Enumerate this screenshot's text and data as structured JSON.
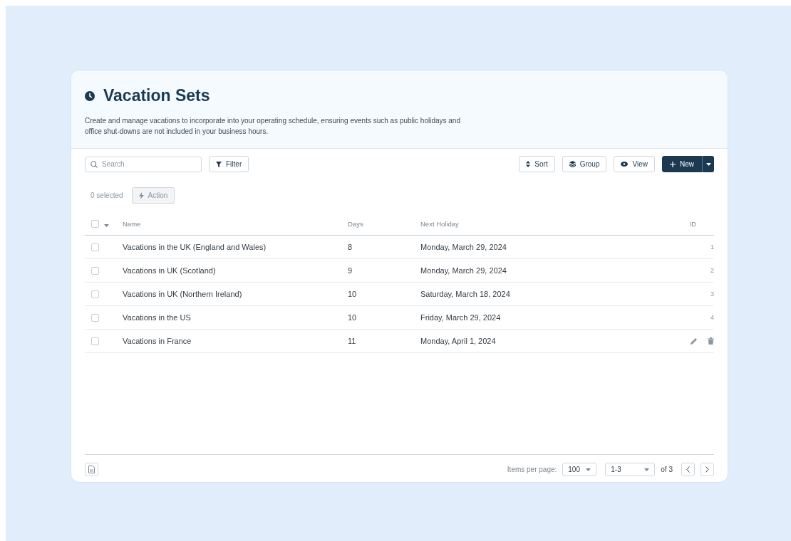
{
  "header": {
    "title": "Vacation Sets",
    "description": "Create and manage vacations to incorporate into your operating schedule, ensuring events such as public holidays and office shut-downs are not included in your business hours."
  },
  "toolbar": {
    "search": {
      "placeholder": "Search"
    },
    "filter": "Filter",
    "sort": "Sort",
    "group": "Group",
    "view": "View",
    "new": "New"
  },
  "selection": {
    "count": "0 selected",
    "action": "Action",
    "action_disabled": true
  },
  "table": {
    "select_all_checked": false,
    "columns": [
      "Name",
      "Days",
      "Next Holiday",
      "ID"
    ],
    "rows": [
      {
        "name": "Vacations in the UK (England and Wales)",
        "days": "8",
        "next_holiday": "Monday, March 29, 2024",
        "id": "1",
        "checked": false,
        "hovered": false
      },
      {
        "name": "Vacations in UK (Scotland)",
        "days": "9",
        "next_holiday": "Monday, March 29, 2024",
        "id": "2",
        "checked": false,
        "hovered": false
      },
      {
        "name": "Vacations in UK (Northern Ireland)",
        "days": "10",
        "next_holiday": "Saturday, March 18, 2024",
        "id": "3",
        "checked": false,
        "hovered": false
      },
      {
        "name": "Vacations in the US",
        "days": "10",
        "next_holiday": "Friday, March 29, 2024",
        "id": "4",
        "checked": false,
        "hovered": false
      },
      {
        "name": "Vacations in France",
        "days": "11",
        "next_holiday": "Monday, April 1, 2024",
        "checked": false,
        "hovered": true
      }
    ]
  },
  "pagination": {
    "items_per_page_label": "Items per page:",
    "items_per_page": "100",
    "range": "1-3",
    "of": "of 3"
  }
}
